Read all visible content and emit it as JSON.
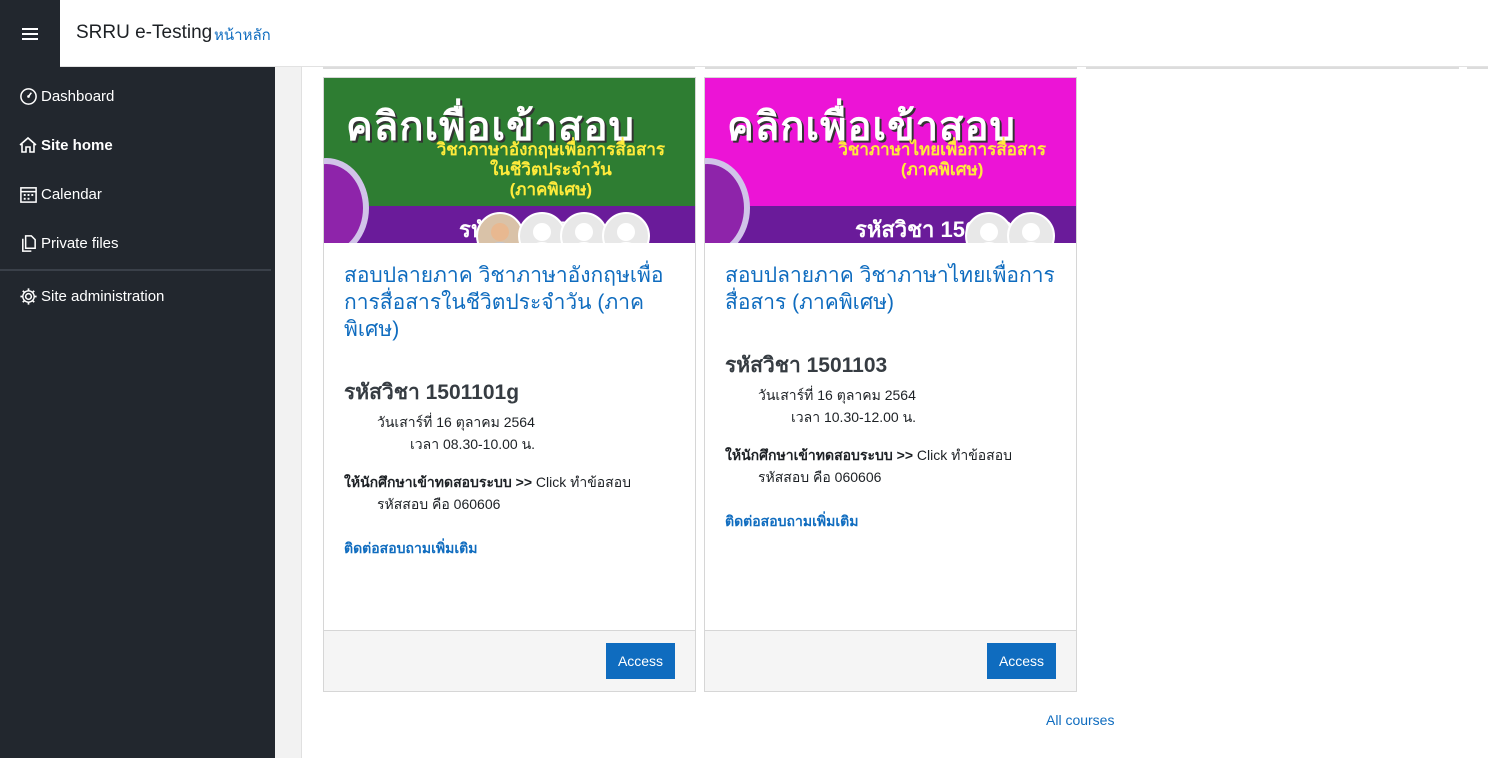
{
  "navbar": {
    "brand": "SRRU e-Testing",
    "home_link": "หน้าหลัก"
  },
  "sidebar": {
    "items": [
      {
        "label": "Dashboard",
        "icon": "dashboard-icon"
      },
      {
        "label": "Site home",
        "icon": "home-icon"
      },
      {
        "label": "Calendar",
        "icon": "calendar-icon"
      },
      {
        "label": "Private files",
        "icon": "files-icon"
      },
      {
        "label": "Site administration",
        "icon": "gear-icon"
      }
    ]
  },
  "courses": [
    {
      "banner": {
        "headline": "คลิกเพื่อเข้าสอบ",
        "subtitle": [
          "วิชาภาษาอังกฤษเพื่อการสื่อสาร",
          "ในชีวิตประจำวัน",
          "(ภาคพิเศษ)"
        ],
        "code": "รหัสวิชา 1501101",
        "bg_color": "#2e7d32"
      },
      "title": "สอบปลายภาค วิชาภาษาอังกฤษเพื่อการสื่อสารในชีวิตประจำวัน (ภาคพิเศษ)",
      "subject_code": "รหัสวิชา 1501101g",
      "date": "วันเสาร์ที่ 16 ตุลาคม 2564",
      "time": "เวลา 08.30-10.00 น.",
      "instruction_bold": "ให้นักศึกษาเข้าทดสอบระบบ >>",
      "instruction_rest": " Click ทำข้อสอบ",
      "password": "รหัสสอบ คือ 060606",
      "contact": "ติดต่อสอบถามเพิ่มเติม",
      "access": "Access"
    },
    {
      "banner": {
        "headline": "คลิกเพื่อเข้าสอบ",
        "subtitle": [
          "วิชาภาษาไทยเพื่อการสื่อสาร",
          "(ภาคพิเศษ)"
        ],
        "code": "รหัสวิชา 1501103",
        "bg_color": "#ec14d6"
      },
      "title": "สอบปลายภาค วิชาภาษาไทยเพื่อการสื่อสาร (ภาคพิเศษ)",
      "subject_code": "รหัสวิชา 1501103",
      "date": "วันเสาร์ที่ 16 ตุลาคม 2564",
      "time": "เวลา 10.30-12.00 น.",
      "instruction_bold": "ให้นักศึกษาเข้าทดสอบระบบ >>",
      "instruction_rest": " Click ทำข้อสอบ",
      "password": "รหัสสอบ คือ 060606",
      "contact": "ติดต่อสอบถามเพิ่มเติม",
      "access": "Access"
    }
  ],
  "all_courses": "All courses",
  "colors": {
    "accent": "#0f6cbf",
    "sidebar_bg": "#22272e"
  }
}
